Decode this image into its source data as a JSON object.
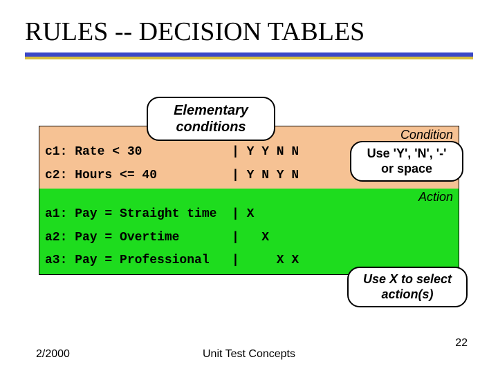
{
  "title": "RULES -- DECISION TABLES",
  "section_conditions_label": "Condition",
  "section_actions_label": "Action",
  "conditions": {
    "r1_lhs": "c1: Rate < 30",
    "r1_rhs": "| Y Y N N",
    "r2_lhs": "c2: Hours <= 40",
    "r2_rhs": "| Y N Y N"
  },
  "actions": {
    "r1_lhs": "a1: Pay = Straight time",
    "r1_rhs": "| X",
    "r2_lhs": "a2: Pay = Overtime",
    "r2_rhs": "|   X",
    "r3_lhs": "a3: Pay = Professional",
    "r3_rhs": "|     X X"
  },
  "callouts": {
    "top": "Elementary conditions",
    "right": "Use 'Y', 'N', '-' or space",
    "bottom": "Use X to select action(s)"
  },
  "footer": {
    "date": "2/2000",
    "center": "Unit Test Concepts",
    "page": "22"
  }
}
